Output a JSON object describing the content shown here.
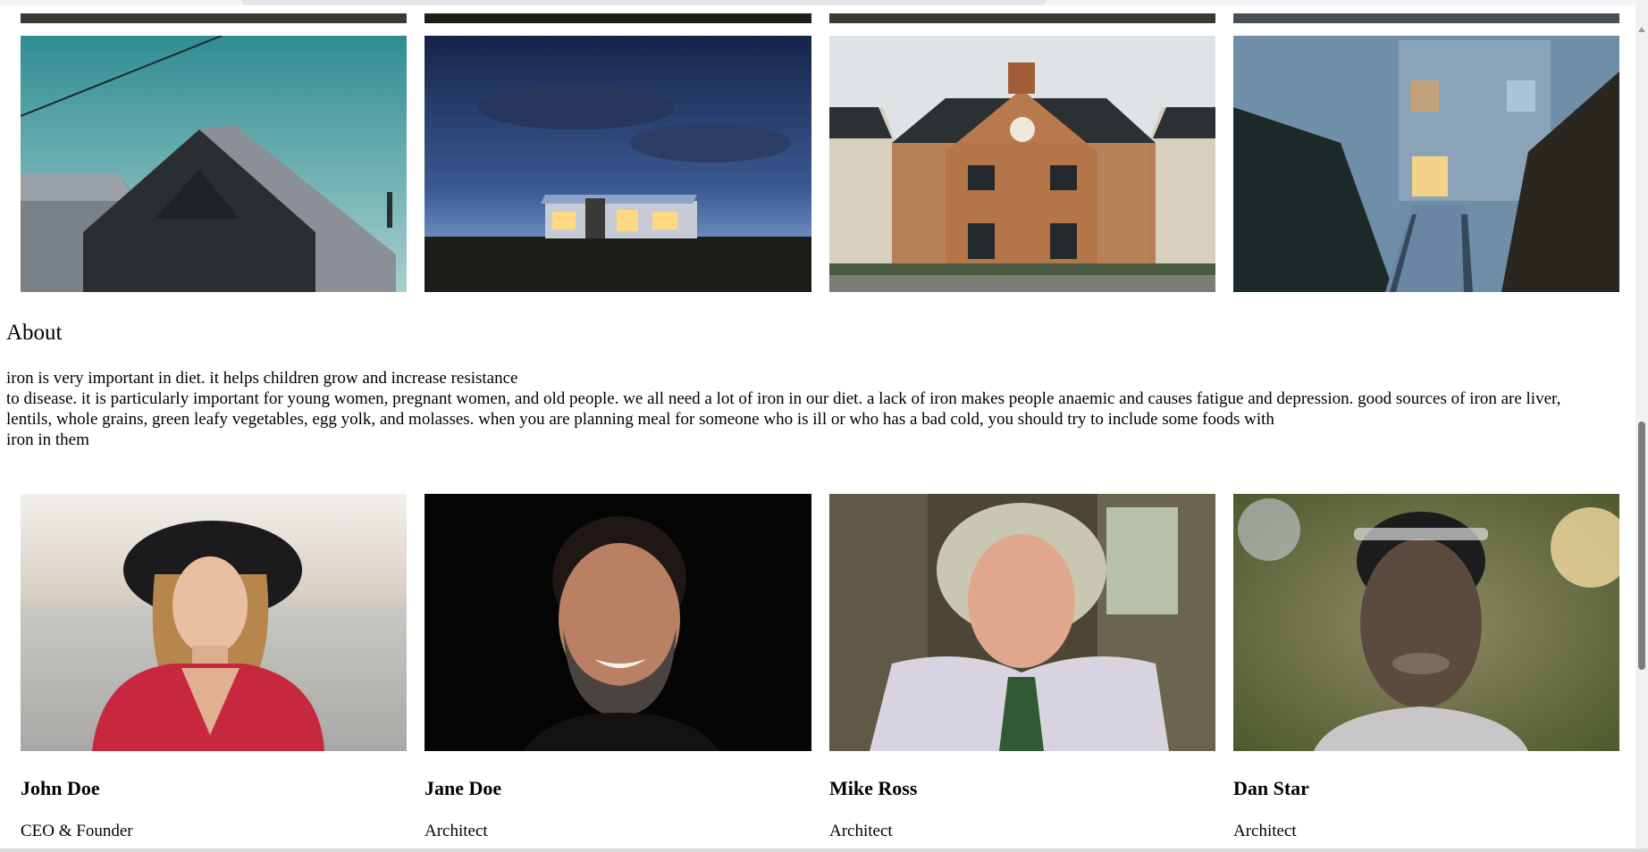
{
  "page": {
    "about_heading": "About",
    "about_lines": [
      "iron is very important in diet. it helps children grow and increase resistance",
      "to disease. it is particularly important for young women, pregnant women, and old people. we all need a lot of iron in our diet. a lack of iron makes people anaemic and causes fatigue and depression. good sources of iron are liver,",
      "lentils, whole grains, green leafy vegetables, egg yolk, and molasses. when you are planning meal for someone who is ill or who has a bad cold, you should try to include some foods with",
      "iron in them"
    ]
  },
  "gallery": {
    "photos": [
      {
        "name": "dark wooden gable house photo"
      },
      {
        "name": "house at dusk under clouds photo"
      },
      {
        "name": "brick house with chimneys photo"
      },
      {
        "name": "house with boardwalk among reeds photo"
      }
    ]
  },
  "team": [
    {
      "name": "John Doe",
      "title": "CEO & Founder"
    },
    {
      "name": "Jane Doe",
      "title": "Architect"
    },
    {
      "name": "Mike Ross",
      "title": "Architect"
    },
    {
      "name": "Dan Star",
      "title": "Architect"
    }
  ]
}
